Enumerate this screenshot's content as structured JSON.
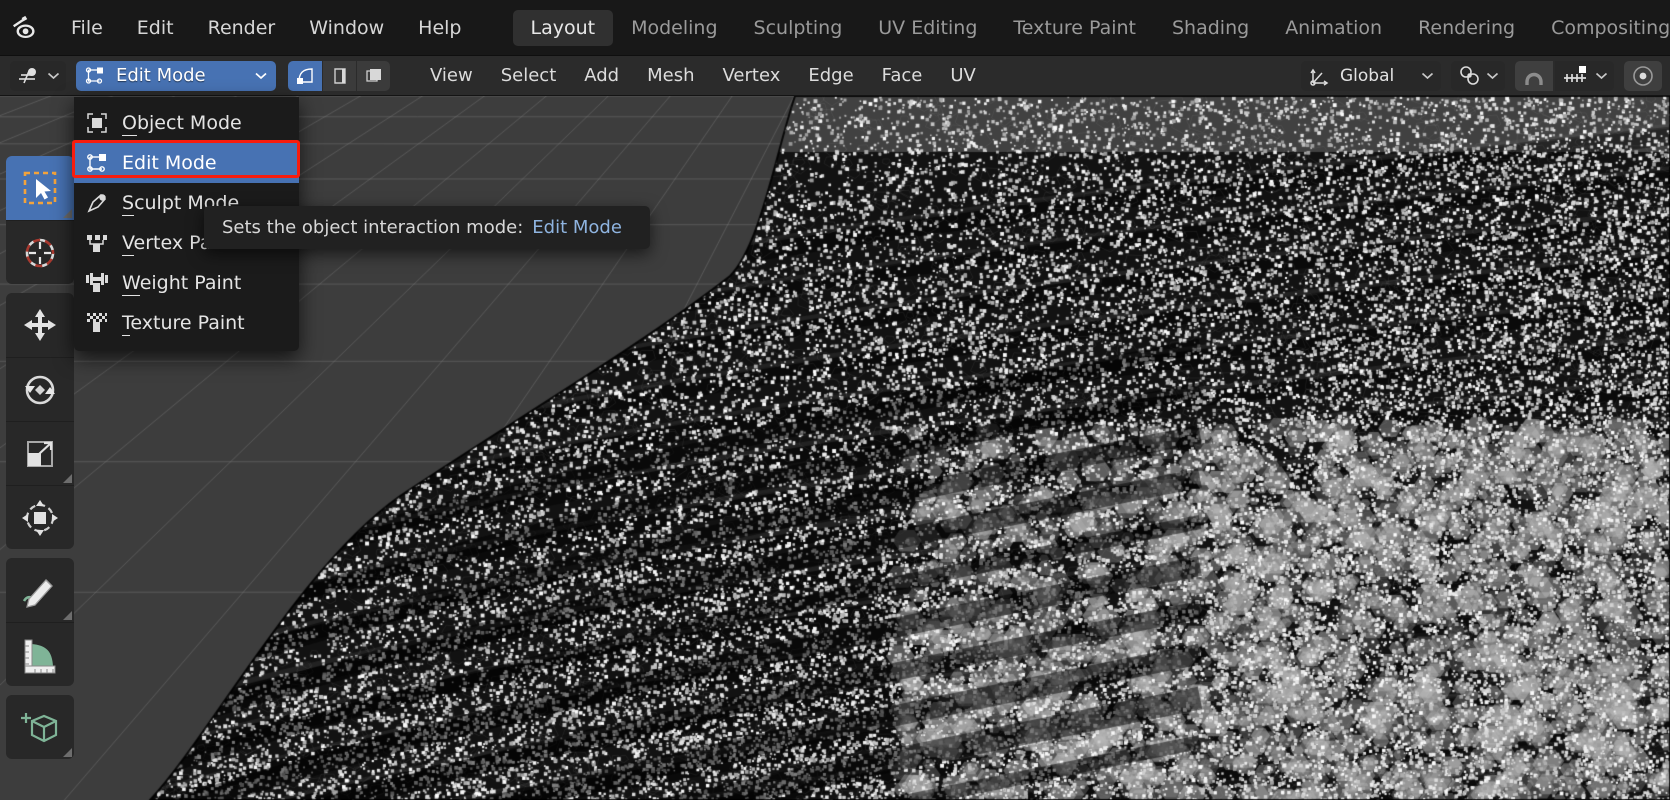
{
  "app": {
    "name": "Blender",
    "logo_icon": "blender-logo-icon"
  },
  "topbar": {
    "menus": [
      {
        "label": "File"
      },
      {
        "label": "Edit"
      },
      {
        "label": "Render"
      },
      {
        "label": "Window"
      },
      {
        "label": "Help"
      }
    ],
    "workspace_tabs": [
      {
        "label": "Layout",
        "active": true
      },
      {
        "label": "Modeling",
        "active": false
      },
      {
        "label": "Sculpting",
        "active": false
      },
      {
        "label": "UV Editing",
        "active": false
      },
      {
        "label": "Texture Paint",
        "active": false
      },
      {
        "label": "Shading",
        "active": false
      },
      {
        "label": "Animation",
        "active": false
      },
      {
        "label": "Rendering",
        "active": false
      },
      {
        "label": "Compositing",
        "active": false
      }
    ]
  },
  "viewport_header": {
    "editor_type_icon": "3d-viewport-editor-icon",
    "editor_type_chevron": "chevron-down-icon",
    "mode_selector": {
      "value": "Edit Mode",
      "icon": "edit-mode-icon",
      "chevron": "chevron-down-icon",
      "expanded": true,
      "accent_color": "#4772b3"
    },
    "select_mode_buttons": [
      {
        "name": "vertex-select-mode",
        "icon": "vertex-select-icon",
        "active": true
      },
      {
        "name": "edge-select-mode",
        "icon": "edge-select-icon",
        "active": false
      },
      {
        "name": "face-select-mode",
        "icon": "face-select-icon",
        "active": false
      }
    ],
    "menus": [
      {
        "label": "View"
      },
      {
        "label": "Select"
      },
      {
        "label": "Add"
      },
      {
        "label": "Mesh"
      },
      {
        "label": "Vertex"
      },
      {
        "label": "Edge"
      },
      {
        "label": "Face"
      },
      {
        "label": "UV"
      }
    ],
    "transform_orientation": {
      "value": "Global",
      "icon": "orientation-axes-icon",
      "chevron": "chevron-down-icon"
    },
    "snap_target": {
      "icon": "snap-magnet-target-icon",
      "chevron": "chevron-down-icon"
    },
    "snap_toggle": {
      "icon": "magnet-icon",
      "enabled": true
    },
    "proportional_edit_falloff": {
      "icon": "proportional-editing-icon",
      "chevron": "chevron-down-icon"
    },
    "proportional_edit_toggle": {
      "icon": "proportional-circle-icon",
      "enabled": false
    }
  },
  "mode_menu": {
    "items": [
      {
        "label": "Object Mode",
        "accel": "O",
        "icon": "object-mode-icon",
        "selected": false
      },
      {
        "label": "Edit Mode",
        "accel": "E",
        "icon": "edit-mode-icon",
        "selected": true
      },
      {
        "label": "Sculpt Mode",
        "accel": "S",
        "icon": "sculpt-mode-icon",
        "selected": false
      },
      {
        "label": "Vertex Paint",
        "accel": "V",
        "icon": "vertex-paint-icon",
        "selected": false
      },
      {
        "label": "Weight Paint",
        "accel": "W",
        "icon": "weight-paint-icon",
        "selected": false
      },
      {
        "label": "Texture Paint",
        "accel": "T",
        "icon": "texture-paint-icon",
        "selected": false
      }
    ],
    "highlight_color": "#f81c0e",
    "selected_color": "#4772b3"
  },
  "tooltip": {
    "text": "Sets the object interaction mode:",
    "value": "Edit Mode"
  },
  "toolbar": {
    "groups": [
      {
        "tools": [
          {
            "name": "tweak-select-box-tool",
            "icon": "select-box-cursor-icon",
            "active": true,
            "has_submenu": true
          },
          {
            "name": "cursor-tool",
            "icon": "3d-cursor-icon",
            "active": false,
            "has_submenu": false
          }
        ]
      },
      {
        "tools": [
          {
            "name": "move-tool",
            "icon": "move-arrows-icon",
            "active": false,
            "has_submenu": false
          },
          {
            "name": "rotate-tool",
            "icon": "rotate-icon",
            "active": false,
            "has_submenu": false
          },
          {
            "name": "scale-tool",
            "icon": "scale-icon",
            "active": false,
            "has_submenu": true
          },
          {
            "name": "transform-tool",
            "icon": "transform-icon",
            "active": false,
            "has_submenu": false
          }
        ]
      },
      {
        "tools": [
          {
            "name": "annotate-tool",
            "icon": "annotate-pencil-icon",
            "active": false,
            "has_submenu": true
          },
          {
            "name": "measure-tool",
            "icon": "measure-ruler-icon",
            "active": false,
            "has_submenu": false
          }
        ]
      },
      {
        "tools": [
          {
            "name": "add-cube-tool",
            "icon": "add-cube-icon",
            "active": false,
            "has_submenu": true
          }
        ]
      }
    ]
  },
  "viewport": {
    "background_color": "#3d3d3d",
    "grid_color": "#505050",
    "object_color": "#131313",
    "vertex_color": "#c8c8c8",
    "description": "Dense polygon mesh shown in Edit Mode with all vertices visible"
  }
}
